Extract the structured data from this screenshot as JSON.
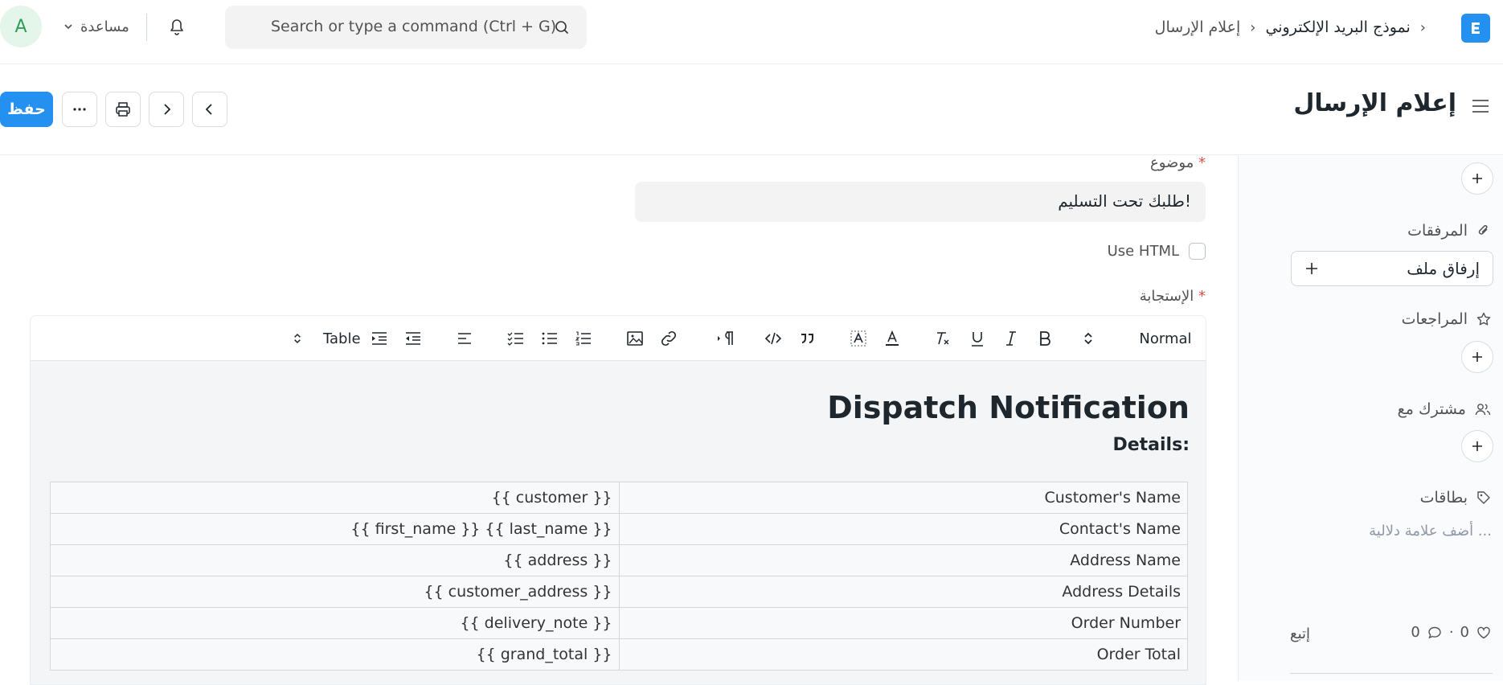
{
  "navbar": {
    "avatar_initial": "A",
    "help_label": "مساعدة",
    "search_placeholder": "Search or type a command (Ctrl + G)",
    "breadcrumb": [
      "نموذج البريد الإلكتروني",
      "إعلام الإرسال"
    ],
    "logo_letter": "E"
  },
  "header": {
    "title": "إعلام الإرسال",
    "save_label": "حفظ"
  },
  "sidebar": {
    "attachments_label": "المرفقات",
    "attach_file_label": "إرفاق ملف",
    "reviews_label": "المراجعات",
    "shared_with_label": "مشترك مع",
    "tags_label": "بطاقات",
    "tags_placeholder": "أضف علامة دلالية ...",
    "likes_count": "0",
    "comments_count": "0",
    "stats_separator": "·",
    "follow_label": "إتبع"
  },
  "form": {
    "subject_label": "موضوع",
    "subject_value": "طلبك تحت التسليم!",
    "required_mark": "*",
    "use_html_label": "Use HTML",
    "response_label": "الإستجابة"
  },
  "toolbar": {
    "style_select": "Normal",
    "table_label": "Table"
  },
  "editor": {
    "heading": "Dispatch Notification",
    "subheading": "Details:",
    "rows": [
      {
        "label": "Customer's Name",
        "value": "{{ customer }}"
      },
      {
        "label": "Contact's Name",
        "value": "{{ first_name }} {{ last_name }}"
      },
      {
        "label": "Address Name",
        "value": "{{ address }}"
      },
      {
        "label": "Address Details",
        "value": "{{ customer_address }}"
      },
      {
        "label": "Order Number",
        "value": "{{ delivery_note }}"
      },
      {
        "label": "Order Total",
        "value": "{{ grand_total }}"
      }
    ]
  },
  "colors": {
    "primary": "#2490ef",
    "required": "#e24c4c",
    "avatar_bg": "#e4f5e9",
    "avatar_fg": "#2f9d58"
  }
}
